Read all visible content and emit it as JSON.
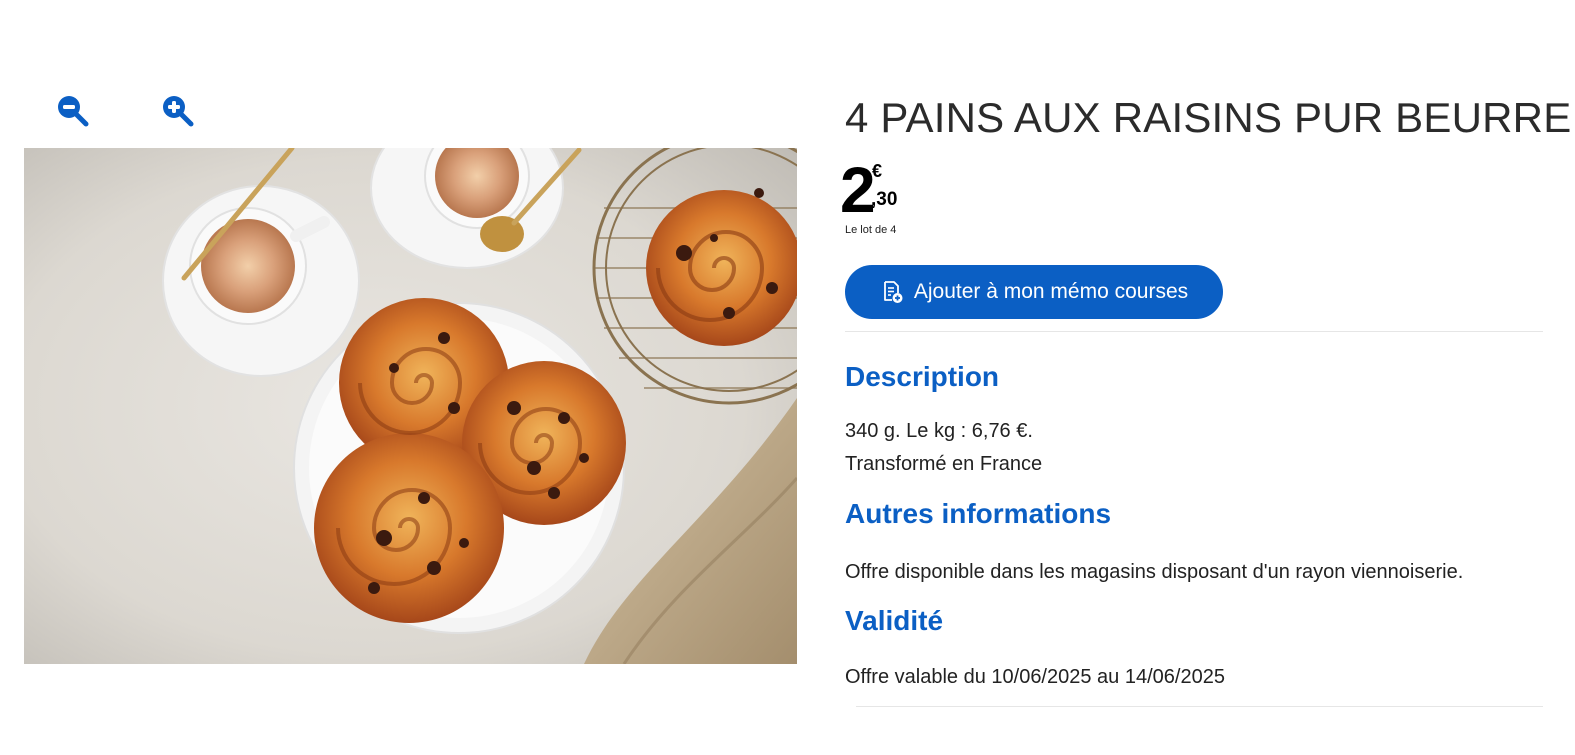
{
  "zoom": {
    "zoom_out_icon": "zoom-out-icon",
    "zoom_in_icon": "zoom-in-icon"
  },
  "image": {
    "subject": "pains aux raisins with coffee"
  },
  "product": {
    "title": "4 PAINS AUX RAISINS PUR BEURRE",
    "price_int": "2",
    "price_currency": "€",
    "price_cents": ",30",
    "price_unit": "Le lot de 4",
    "memo_button_label": "Ajouter à mon mémo courses",
    "memo_button_icon": "note-add-icon"
  },
  "description": {
    "heading": "Description",
    "line1": "340 g. Le kg : 6,76 €.",
    "line2": "Transformé en France"
  },
  "autres": {
    "heading": "Autres informations",
    "text": "Offre disponible dans les magasins disposant d'un rayon viennoiserie."
  },
  "validite": {
    "heading": "Validité",
    "text": "Offre valable du 10/06/2025 au 14/06/2025"
  },
  "colors": {
    "accent": "#0b5fc4",
    "text": "#222222",
    "background": "#ffffff"
  }
}
